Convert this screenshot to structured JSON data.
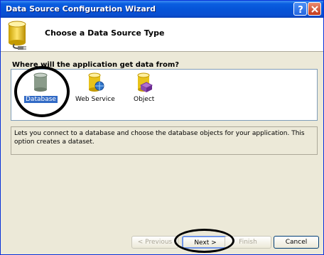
{
  "window": {
    "title": "Data Source Configuration Wizard"
  },
  "header": {
    "title": "Choose a Data Source Type",
    "icon": "database-plug-icon"
  },
  "question": "Where will the application get data from?",
  "sources": [
    {
      "label": "Database",
      "icon": "database-icon",
      "selected": true
    },
    {
      "label": "Web Service",
      "icon": "web-service-icon",
      "selected": false
    },
    {
      "label": "Object",
      "icon": "object-icon",
      "selected": false
    }
  ],
  "description": "Lets you connect to a database and choose the database objects for your application. This option creates a dataset.",
  "buttons": {
    "previous": "< Previous",
    "next": "Next >",
    "finish": "Finish",
    "cancel": "Cancel"
  },
  "colors": {
    "titlebar": "#0654d8",
    "selection": "#316ac5",
    "dialog_bg": "#ece9d8"
  }
}
